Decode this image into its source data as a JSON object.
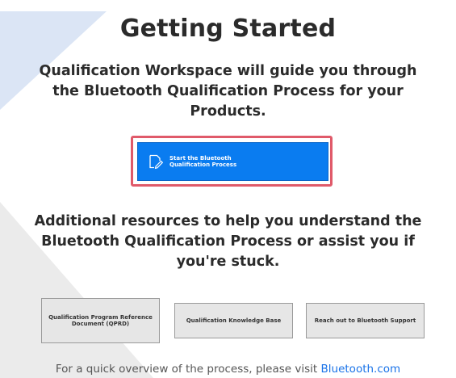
{
  "header": {
    "title": "Getting Started"
  },
  "intro": {
    "text": "Qualification Workspace will guide you through the Bluetooth Qualification Process for your Products."
  },
  "start_button": {
    "label": "Start the Bluetooth Qualification Process",
    "icon": "edit-document-icon",
    "color": "#0a7cf0",
    "highlight_color": "#e05a6a"
  },
  "resources": {
    "text": "Additional resources to help you understand the Bluetooth Qualification Process or assist you if you're stuck.",
    "buttons": [
      {
        "label": "Qualification Program Reference Document (QPRD)"
      },
      {
        "label": "Qualification Knowledge Base"
      },
      {
        "label": "Reach out to Bluetooth Support"
      }
    ]
  },
  "footer": {
    "text": "For a quick overview of the process, please visit",
    "link_label": "Bluetooth.com",
    "link_color": "#1a73e8"
  }
}
